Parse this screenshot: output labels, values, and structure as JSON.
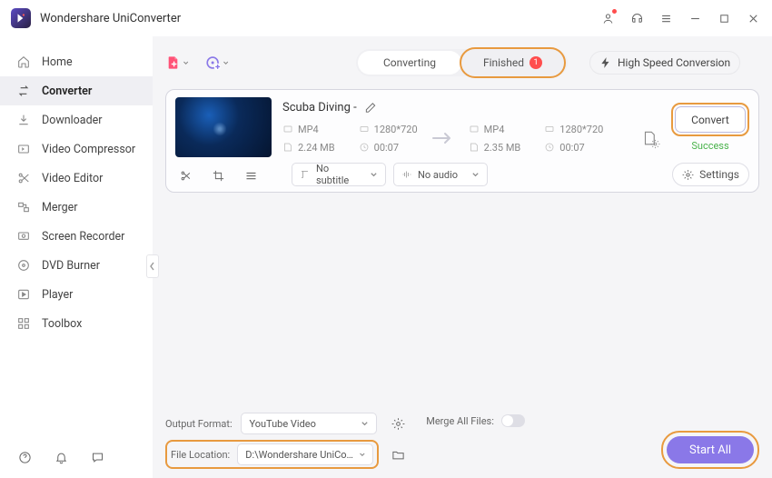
{
  "app": {
    "title": "Wondershare UniConverter"
  },
  "sidebar": {
    "items": [
      {
        "label": "Home"
      },
      {
        "label": "Converter"
      },
      {
        "label": "Downloader"
      },
      {
        "label": "Video Compressor"
      },
      {
        "label": "Video Editor"
      },
      {
        "label": "Merger"
      },
      {
        "label": "Screen Recorder"
      },
      {
        "label": "DVD Burner"
      },
      {
        "label": "Player"
      },
      {
        "label": "Toolbox"
      }
    ]
  },
  "tabs": {
    "converting": "Converting",
    "finished": "Finished",
    "finished_count": "1"
  },
  "highspeed": {
    "label": "High Speed Conversion"
  },
  "file": {
    "title": "Scuba Diving -",
    "src": {
      "format": "MP4",
      "resolution": "1280*720",
      "size": "2.24 MB",
      "duration": "00:07"
    },
    "dst": {
      "format": "MP4",
      "resolution": "1280*720",
      "size": "2.35 MB",
      "duration": "00:07"
    },
    "subtitle": "No subtitle",
    "audio": "No audio",
    "convert_label": "Convert",
    "status": "Success",
    "settings": "Settings"
  },
  "footer": {
    "output_format_label": "Output Format:",
    "output_format_value": "YouTube Video",
    "file_location_label": "File Location:",
    "file_location_value": "D:\\Wondershare UniConverter",
    "merge_label": "Merge All Files:",
    "start_all": "Start All"
  }
}
